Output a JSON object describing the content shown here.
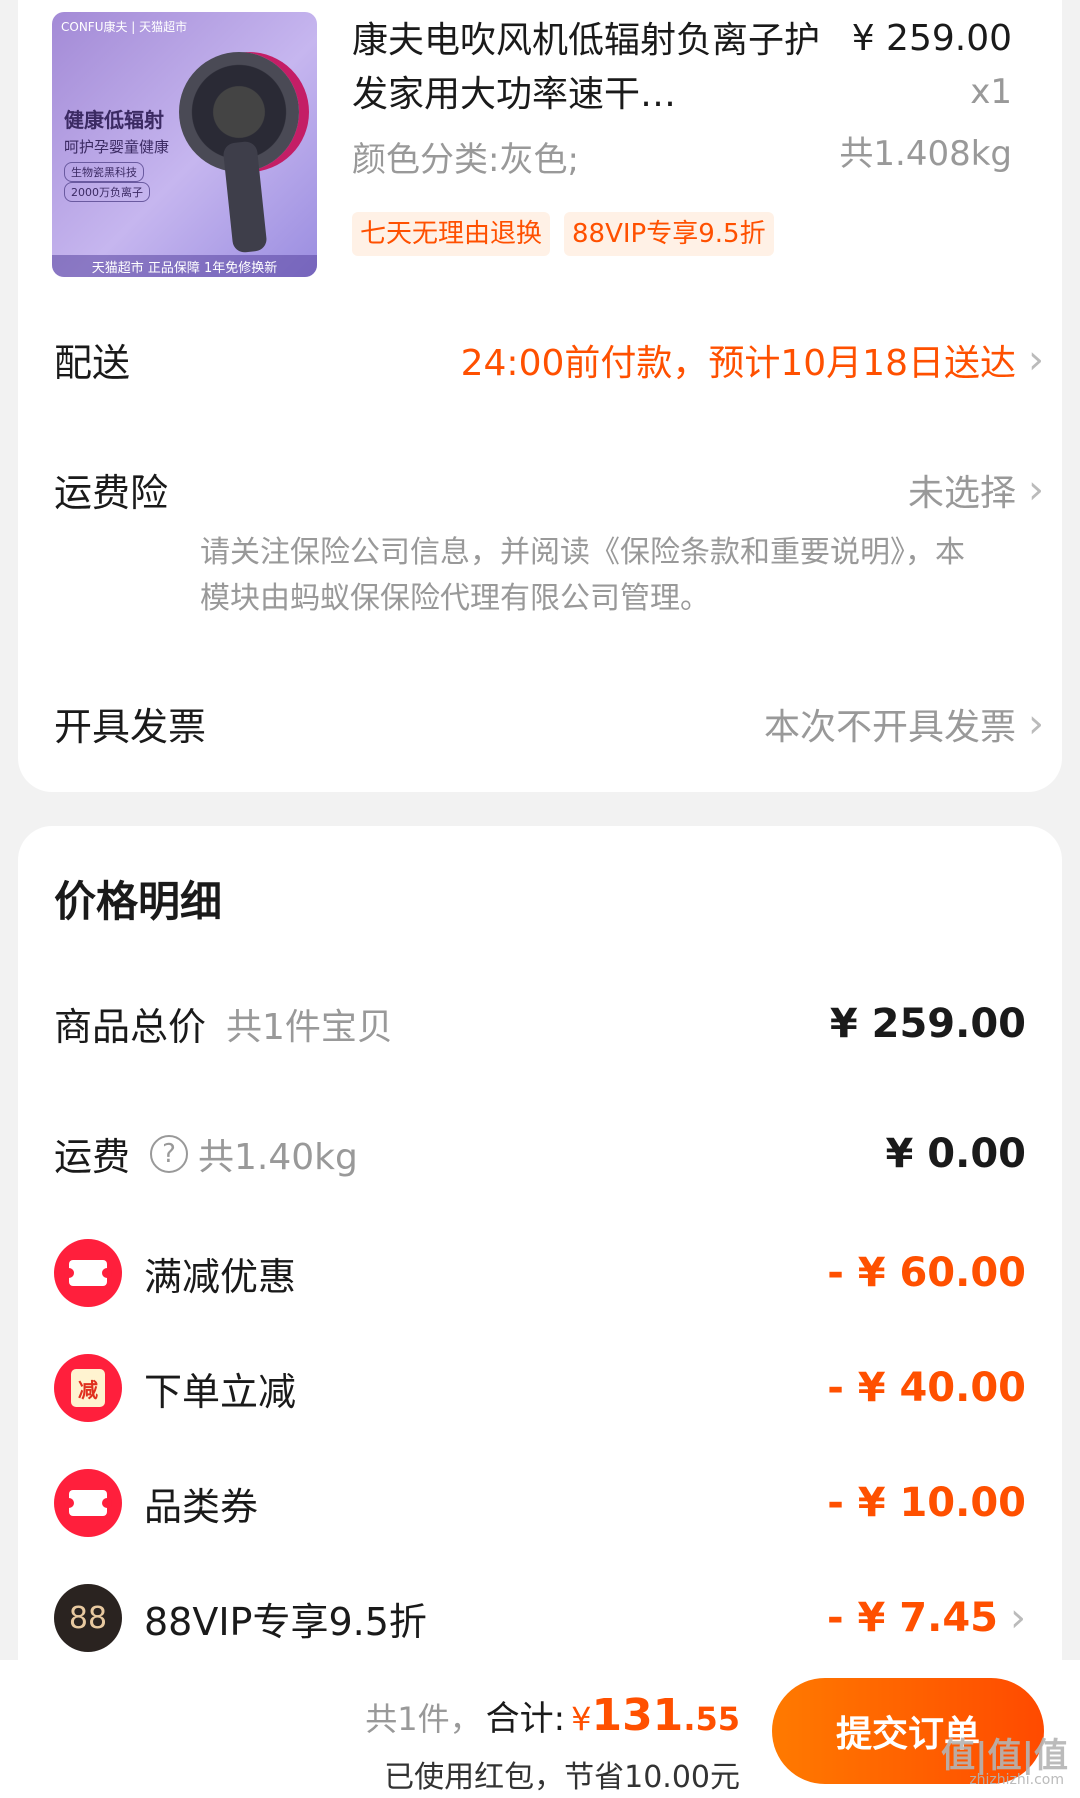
{
  "product": {
    "thumb_brand": "CONFU康夫 | 天猫超市",
    "thumb_tag1": "健康低辐射",
    "thumb_tag2": "呵护孕婴童健康",
    "thumb_pill1": "生物瓷黑科技",
    "thumb_pill2": "2000万负离子",
    "thumb_footer": "天猫超市  正品保障  1年免修换新",
    "title": "康夫电吹风机低辐射负离子护发家用大功率速干…",
    "price": "¥ 259.00",
    "qty": "x1",
    "weight": "共1.408kg",
    "spec": "颜色分类:灰色;",
    "badges": [
      "七天无理由退换",
      "88VIP专享9.5折"
    ]
  },
  "delivery": {
    "label": "配送",
    "value": "24:00前付款，预计10月18日送达"
  },
  "insurance": {
    "label": "运费险",
    "value": "未选择",
    "note": "请关注保险公司信息，并阅读《保险条款和重要说明》，本模块由蚂蚁保保险代理有限公司管理。"
  },
  "invoice": {
    "label": "开具发票",
    "value": "本次不开具发票"
  },
  "price_detail": {
    "title": "价格明细",
    "goods_total_label": "商品总价",
    "goods_total_sub": "共1件宝贝",
    "goods_total_amount": "¥ 259.00",
    "shipping_label": "运费",
    "shipping_help_icon": "?",
    "shipping_sub": "共1.40kg",
    "shipping_amount": "¥ 0.00",
    "discounts": [
      {
        "label": "满减优惠",
        "amount": "- ¥ 60.00",
        "icon": "ticket-icon"
      },
      {
        "label": "下单立减",
        "amount": "- ¥ 40.00",
        "icon": "jian-icon",
        "icon_text": "减"
      },
      {
        "label": "品类券",
        "amount": "- ¥ 10.00",
        "icon": "ticket-icon"
      },
      {
        "label": "88VIP专享9.5折",
        "amount": "- ¥ 7.45",
        "icon": "vip88-icon",
        "icon_text": "88"
      }
    ]
  },
  "bottom": {
    "count": "共1件，",
    "total_label": "合计:",
    "currency": "¥",
    "total_int": "131",
    "total_dec": ".55",
    "saving": "已使用红包，节省10.00元",
    "submit": "提交订单"
  },
  "watermark": {
    "main": "值|值|值",
    "sub": "zhizhizhi.com"
  },
  "colors": {
    "accent": "#ff5000",
    "discount_red": "#ff1f3c",
    "muted": "#999999"
  }
}
